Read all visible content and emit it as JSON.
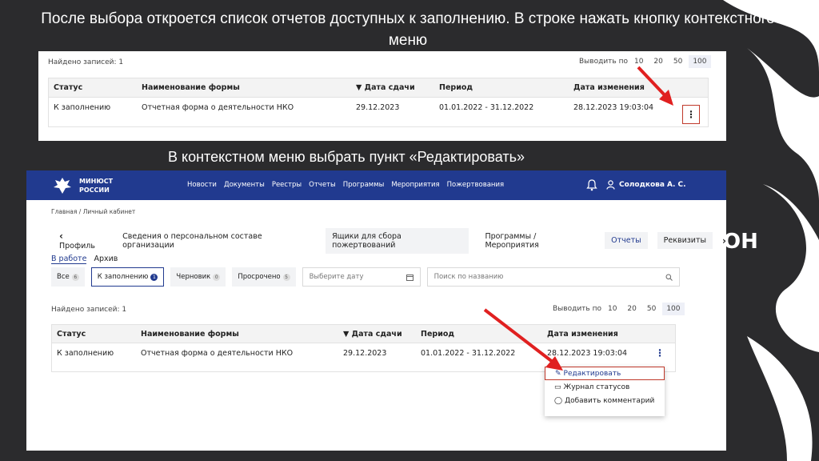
{
  "slide": {
    "title": "После выбора откроется список отчетов доступных к заполнению. В строке нажать кнопку контекстного меню",
    "subtitle": "В контекстном меню выбрать пункт «Редактировать»"
  },
  "top_panel": {
    "found": "Найдено записей: 1",
    "per_page_label": "Выводить по",
    "per_page_options": [
      "10",
      "20",
      "50",
      "100"
    ],
    "columns": [
      "Статус",
      "Наименование формы",
      "▼ Дата сдачи",
      "Период",
      "Дата изменения"
    ],
    "row": [
      "К заполнению",
      "Отчетная форма о деятельности НКО",
      "29.12.2023",
      "01.01.2022 - 31.12.2022",
      "28.12.2023 19:03:04"
    ],
    "menu_icon": "⋮"
  },
  "site": {
    "logo_line1": "МИНЮСТ",
    "logo_line2": "РОССИИ",
    "nav": [
      "Новости",
      "Документы",
      "Реестры",
      "Отчеты",
      "Программы",
      "Мероприятия",
      "Пожертвования"
    ],
    "user": "Солодкова А. С.",
    "breadcrumb": "Главная / Личный кабинет",
    "tabs": {
      "back": "Профиль",
      "items": [
        "Сведения о персональном составе организации",
        "Ящики для сбора пожертвований",
        "Программы / Мероприятия",
        "Отчеты",
        "Реквизиты"
      ]
    },
    "subtabs": [
      "В работе",
      "Архив"
    ],
    "filters": {
      "chips": [
        {
          "label": "Все",
          "count": "6"
        },
        {
          "label": "К заполнению",
          "count": "1"
        },
        {
          "label": "Черновик",
          "count": "0"
        },
        {
          "label": "Просрочено",
          "count": "5"
        }
      ],
      "date_placeholder": "Выберите дату",
      "search_placeholder": "Поиск по названию"
    },
    "found": "Найдено записей: 1",
    "per_page_label": "Выводить по",
    "per_page_options": [
      "10",
      "20",
      "50",
      "100"
    ],
    "columns": [
      "Статус",
      "Наименование формы",
      "▼ Дата сдачи",
      "Период",
      "Дата изменения"
    ],
    "row": [
      "К заполнению",
      "Отчетная форма о деятельности НКО",
      "29.12.2023",
      "01.01.2022 - 31.12.2022",
      "28.12.2023 19:03:04"
    ],
    "context_menu": [
      "Редактировать",
      "Журнал статусов",
      "Добавить комментарий"
    ]
  },
  "colors": {
    "accent": "#213a8f",
    "highlight": "#c0392b",
    "arrow": "#e02020",
    "background": "#2b2b2d"
  }
}
